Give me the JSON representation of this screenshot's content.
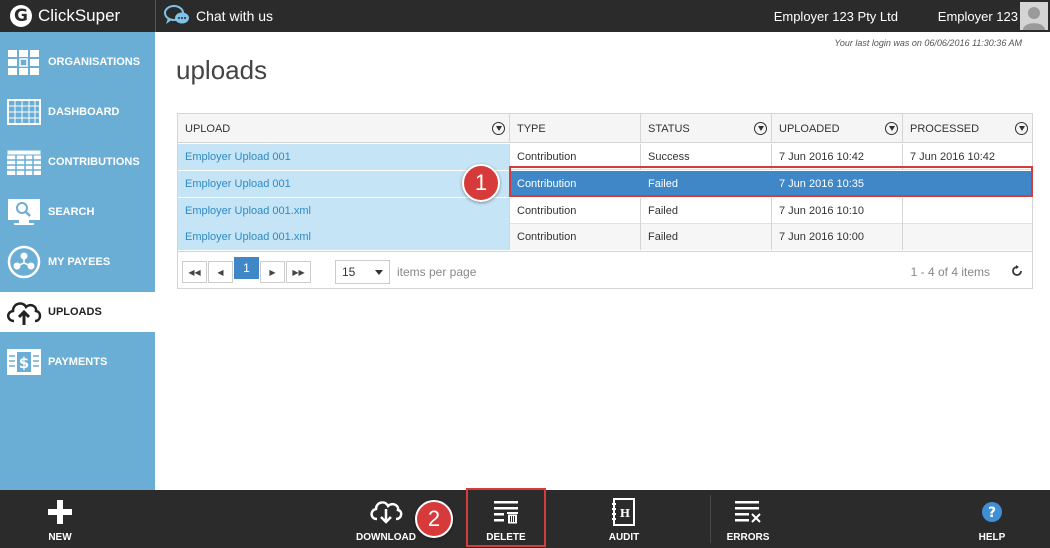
{
  "app": {
    "logo_letter": "G",
    "name": "ClickSuper"
  },
  "header": {
    "chat_label": "Chat with us",
    "employer": "Employer 123 Pty Ltd",
    "user": "Employer 123"
  },
  "sidebar": {
    "items": [
      {
        "label": "ORGANISATIONS",
        "icon": "organisations-icon"
      },
      {
        "label": "DASHBOARD",
        "icon": "dashboard-icon"
      },
      {
        "label": "CONTRIBUTIONS",
        "icon": "contributions-icon"
      },
      {
        "label": "SEARCH",
        "icon": "search-monitor-icon"
      },
      {
        "label": "MY PAYEES",
        "icon": "payees-icon"
      },
      {
        "label": "UPLOADS",
        "icon": "cloud-upload-icon",
        "active": true
      },
      {
        "label": "PAYMENTS",
        "icon": "payments-icon"
      }
    ]
  },
  "main": {
    "last_login": "Your last login was on 06/06/2016 11:30:36 AM",
    "title": "uploads"
  },
  "table": {
    "columns": [
      "UPLOAD",
      "TYPE",
      "STATUS",
      "UPLOADED",
      "PROCESSED"
    ],
    "rows": [
      [
        "Employer Upload 001",
        "Contribution",
        "Success",
        "7 Jun 2016 10:42",
        "7 Jun 2016 10:42"
      ],
      [
        "Employer Upload 001",
        "Contribution",
        "Failed",
        "7 Jun 2016 10:35",
        ""
      ],
      [
        "Employer Upload 001.xml",
        "Contribution",
        "Failed",
        "7 Jun 2016 10:10",
        ""
      ],
      [
        "Employer Upload 001.xml",
        "Contribution",
        "Failed",
        "7 Jun 2016 10:00",
        ""
      ]
    ],
    "selected_row": 1
  },
  "pager": {
    "current_page": "1",
    "page_size": "15",
    "page_size_label": "items per page",
    "count_label": "1 - 4 of 4 items"
  },
  "callouts": {
    "one": "1",
    "two": "2"
  },
  "toolbar": {
    "new": "NEW",
    "download": "DOWNLOAD",
    "delete": "DELETE",
    "audit": "AUDIT",
    "errors": "ERRORS",
    "help": "HELP"
  },
  "colors": {
    "sidebar": "#6aaed5",
    "bar": "#2b2b2b",
    "selected": "#3f87c7",
    "callout": "#d63a3a"
  }
}
